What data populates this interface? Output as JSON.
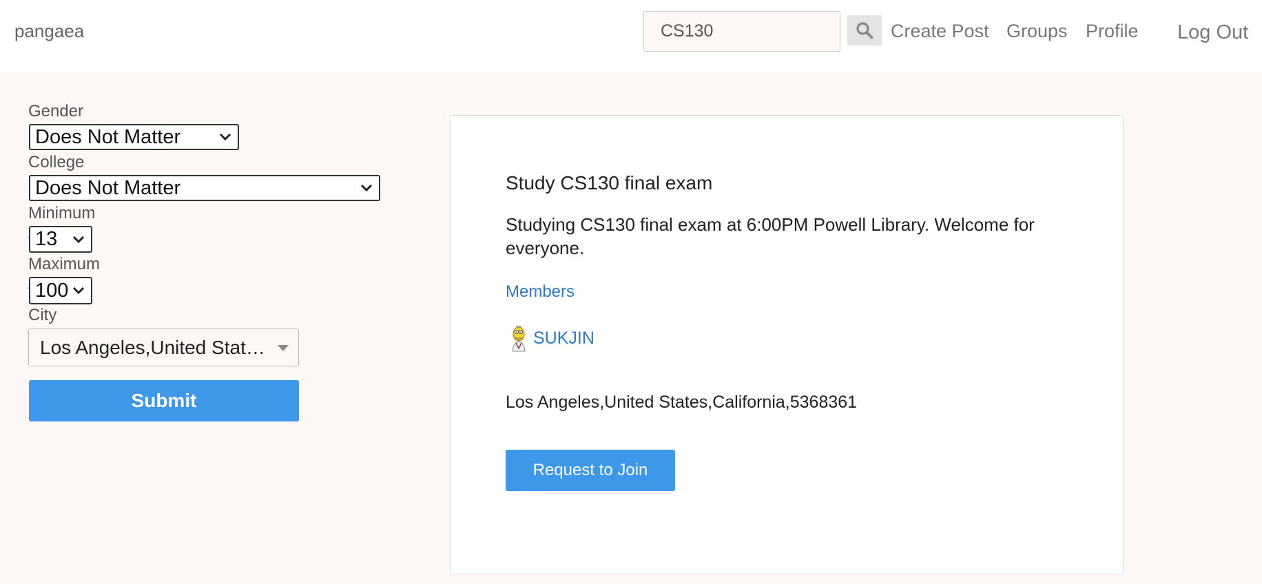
{
  "header": {
    "brand": "pangaea",
    "search": {
      "value": "CS130",
      "placeholder": ""
    },
    "nav": {
      "create_post": "Create Post",
      "groups": "Groups",
      "profile": "Profile",
      "logout": "Log Out"
    },
    "icons": {
      "search": "search-icon"
    }
  },
  "filters": {
    "gender": {
      "label": "Gender",
      "value": "Does Not Matter"
    },
    "college": {
      "label": "College",
      "value": "Does Not Matter"
    },
    "min_age": {
      "label": "Minimum Age",
      "value": "13"
    },
    "max_age": {
      "label": "Maximum Age",
      "value": "100"
    },
    "city": {
      "label": "City",
      "value": "Los Angeles,United States,California,5368361"
    },
    "submit_label": "Submit"
  },
  "post": {
    "title": "Study CS130 final exam",
    "description": "Studying CS130 final exam at 6:00PM Powell Library. Welcome for everyone.",
    "members_label": "Members",
    "members": [
      {
        "name": "SUKJIN",
        "avatar": "cartoon-avatar-icon"
      }
    ],
    "location": "Los Angeles,United States,California,5368361",
    "join_label": "Request to Join"
  },
  "colors": {
    "accent": "#3d98ea",
    "link": "#2e7bc4",
    "page_background": "#fdf8f6",
    "text": "#222222",
    "muted_text": "#777777"
  }
}
